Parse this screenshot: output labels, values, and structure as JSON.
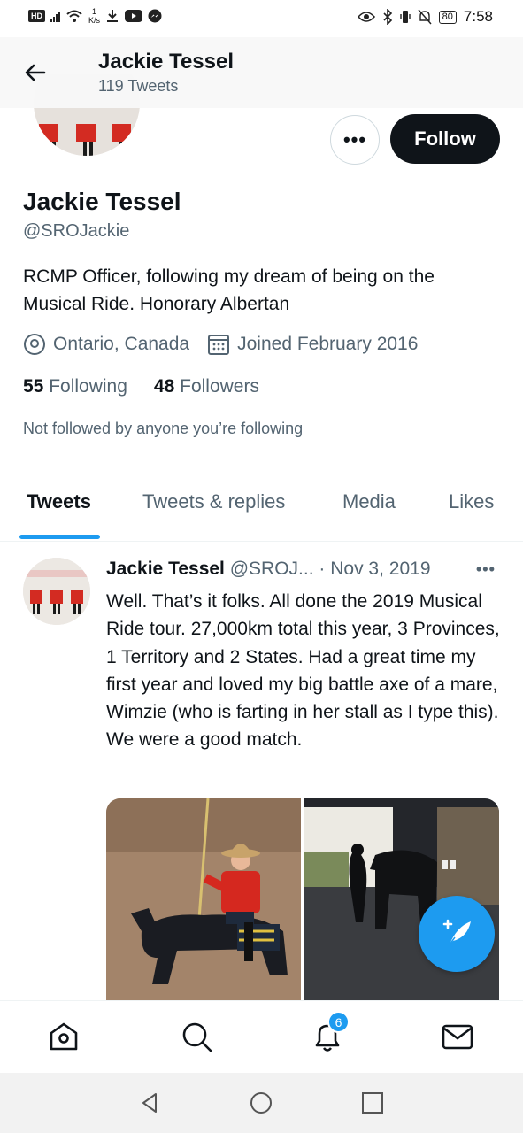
{
  "status_bar": {
    "hd": "HD",
    "speed_value": "1",
    "speed_unit": "K/s",
    "battery": "80",
    "time": "7:58"
  },
  "header": {
    "title": "Jackie Tessel",
    "subtitle": "119 Tweets"
  },
  "profile": {
    "more_label": "•••",
    "follow_label": "Follow",
    "name": "Jackie Tessel",
    "handle": "@SROJackie",
    "bio": "RCMP Officer, following my dream of being on the Musical Ride. Honorary Albertan",
    "location": "Ontario, Canada",
    "joined": "Joined February 2016",
    "following_count": "55",
    "following_label": "Following",
    "followers_count": "48",
    "followers_label": "Followers",
    "not_followed": "Not followed by anyone you’re following"
  },
  "tabs": [
    "Tweets",
    "Tweets & replies",
    "Media",
    "Likes"
  ],
  "tweet": {
    "author": "Jackie Tessel",
    "handle": "@SROJ...",
    "separator": "·",
    "date": "Nov 3, 2019",
    "more_label": "•••",
    "text": "Well. That’s it folks. All done the 2019 Musical Ride tour. 27,000km total this year, 3 Provinces, 1 Territory and 2 States. Had a great time my first year and loved my big battle axe of a mare, Wimzie (who is farting in her stall as I type this). We were a good match."
  },
  "bottom_nav": {
    "notifications_badge": "6"
  },
  "colors": {
    "accent": "#1d9bf0",
    "text_primary": "#0f1419",
    "text_secondary": "#536471"
  }
}
